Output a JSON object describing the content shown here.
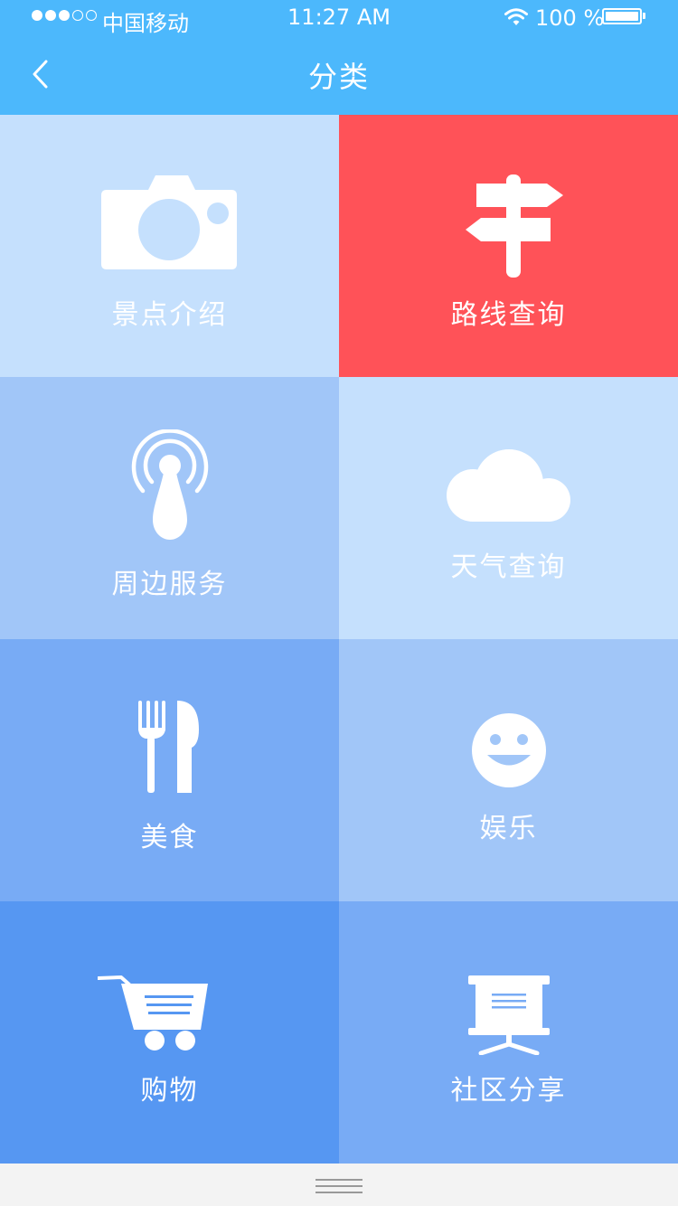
{
  "status_bar": {
    "carrier": "中国移动",
    "time": "11:27 AM",
    "battery_text": "100 %",
    "signal_bars_filled": 3,
    "signal_bars_total": 5
  },
  "nav": {
    "title": "分类",
    "back_icon": "chevron-left-icon"
  },
  "colors": {
    "header": "#4cb8fc",
    "tile_light": "#c5e0fd",
    "tile_red": "#ff5258",
    "tile_mid": "#a1c6f8",
    "tile_blue": "#78abf5",
    "tile_deep": "#5697f2"
  },
  "categories": [
    {
      "label": "景点介绍",
      "icon": "camera-icon",
      "color": "#c5e0fd"
    },
    {
      "label": "路线查询",
      "icon": "signpost-icon",
      "color": "#ff5258"
    },
    {
      "label": "周边服务",
      "icon": "location-signal-icon",
      "color": "#a1c6f8"
    },
    {
      "label": "天气查询",
      "icon": "cloud-icon",
      "color": "#c5e0fd"
    },
    {
      "label": "美食",
      "icon": "fork-knife-icon",
      "color": "#78abf5"
    },
    {
      "label": "娱乐",
      "icon": "smiley-icon",
      "color": "#a1c6f8"
    },
    {
      "label": "购物",
      "icon": "shopping-cart-icon",
      "color": "#5697f2"
    },
    {
      "label": "社区分享",
      "icon": "presentation-board-icon",
      "color": "#78abf5"
    }
  ],
  "bottom_bar": {
    "icon": "drag-handle-icon"
  }
}
